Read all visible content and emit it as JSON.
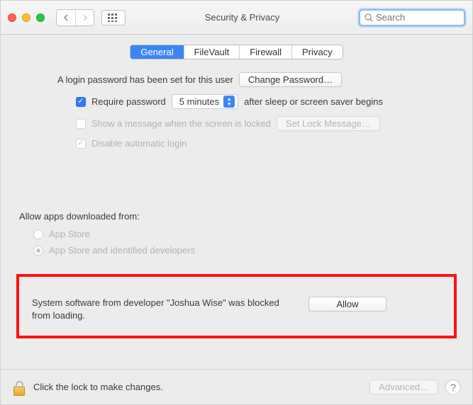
{
  "window": {
    "title": "Security & Privacy"
  },
  "search": {
    "placeholder": "Search",
    "value": ""
  },
  "tabs": [
    {
      "label": "General",
      "active": true
    },
    {
      "label": "FileVault",
      "active": false
    },
    {
      "label": "Firewall",
      "active": false
    },
    {
      "label": "Privacy",
      "active": false
    }
  ],
  "general": {
    "login_password_text": "A login password has been set for this user",
    "change_password_btn": "Change Password…",
    "require_password_label": "Require password",
    "require_password_delay": "5 minutes",
    "require_password_after": "after sleep or screen saver begins",
    "show_message_label": "Show a message when the screen is locked",
    "set_lock_msg_btn": "Set Lock Message…",
    "disable_auto_login_label": "Disable automatic login"
  },
  "downloads": {
    "heading": "Allow apps downloaded from:",
    "options": [
      {
        "label": "App Store",
        "checked": false
      },
      {
        "label": "App Store and identified developers",
        "checked": true
      }
    ]
  },
  "blocked": {
    "message": "System software from developer \"Joshua Wise\" was blocked from loading.",
    "allow_btn": "Allow"
  },
  "footer": {
    "lock_text": "Click the lock to make changes.",
    "advanced_btn": "Advanced…"
  }
}
